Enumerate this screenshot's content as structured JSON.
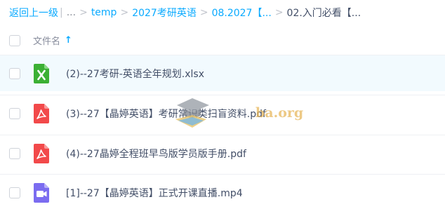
{
  "breadcrumb": {
    "back_label": "返回上一级",
    "pipe": "|",
    "ellipsis": "...",
    "separator": ">",
    "items": [
      "temp",
      "2027考研英语",
      "08.2027【...",
      "02.入门必看【..."
    ]
  },
  "list_header": {
    "column_label": "文件名",
    "sort_arrow": "↑"
  },
  "files": [
    {
      "name": "(2)--27考研-英语全年规划.xlsx",
      "icon": "excel-icon",
      "color": "#3cb034",
      "selected": false
    },
    {
      "name": "(3)--27【晶婷英语】考研常识类扫盲资料.pdf",
      "icon": "pdf-icon",
      "color": "#f2494a",
      "selected": false
    },
    {
      "name": "(4)--27晶婷全程班早鸟版学员版手册.pdf",
      "icon": "pdf-icon",
      "color": "#f2494a",
      "selected": false
    },
    {
      "name": "[1]--27【晶婷英语】正式开课直播.mp4",
      "icon": "video-icon",
      "color": "#7b6cf0",
      "selected": false
    }
  ],
  "watermark_text": "ba.org",
  "colors": {
    "accent": "#09aaff",
    "row_highlight": "#f2fafe",
    "text": "#424e67"
  }
}
